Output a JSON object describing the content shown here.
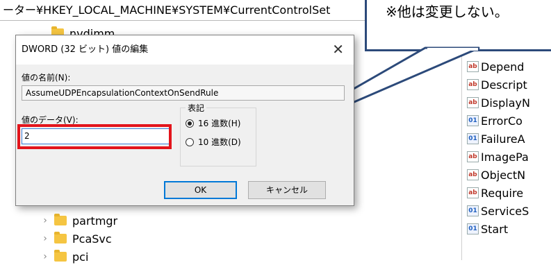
{
  "address_bar": "ーター¥HKEY_LOCAL_MACHINE¥SYSTEM¥CurrentControlSet",
  "tree": {
    "top_item": "nvdimm",
    "items": [
      "partmgr",
      "PcaSvc",
      "pci"
    ]
  },
  "values_pane": {
    "items": [
      {
        "icon": "ab",
        "name": "Depend"
      },
      {
        "icon": "ab",
        "name": "Descript"
      },
      {
        "icon": "ab",
        "name": "DisplayN"
      },
      {
        "icon": "bin",
        "name": "ErrorCo"
      },
      {
        "icon": "bin",
        "name": "FailureA"
      },
      {
        "icon": "ab",
        "name": "ImagePa"
      },
      {
        "icon": "ab",
        "name": "ObjectN"
      },
      {
        "icon": "ab",
        "name": "Require"
      },
      {
        "icon": "bin",
        "name": "ServiceS"
      },
      {
        "icon": "bin",
        "name": "Start"
      }
    ]
  },
  "callout": {
    "text": "※他は変更しない。"
  },
  "dialog": {
    "title": "DWORD (32 ビット) 値の編集",
    "close": "✕",
    "name_label": "値の名前(N):",
    "name_value": "AssumeUDPEncapsulationContextOnSendRule",
    "data_label": "値のデータ(V):",
    "data_value": "2",
    "base_group_label": "表記",
    "radio_hex": "16 進数(H)",
    "radio_dec": "10 進数(D)",
    "radio_selected": "hex",
    "ok_label": "OK",
    "cancel_label": "キャンセル"
  },
  "colors": {
    "highlight": "#e3141b",
    "callout_border": "#2c4a7a",
    "focus_border": "#0078d7"
  }
}
